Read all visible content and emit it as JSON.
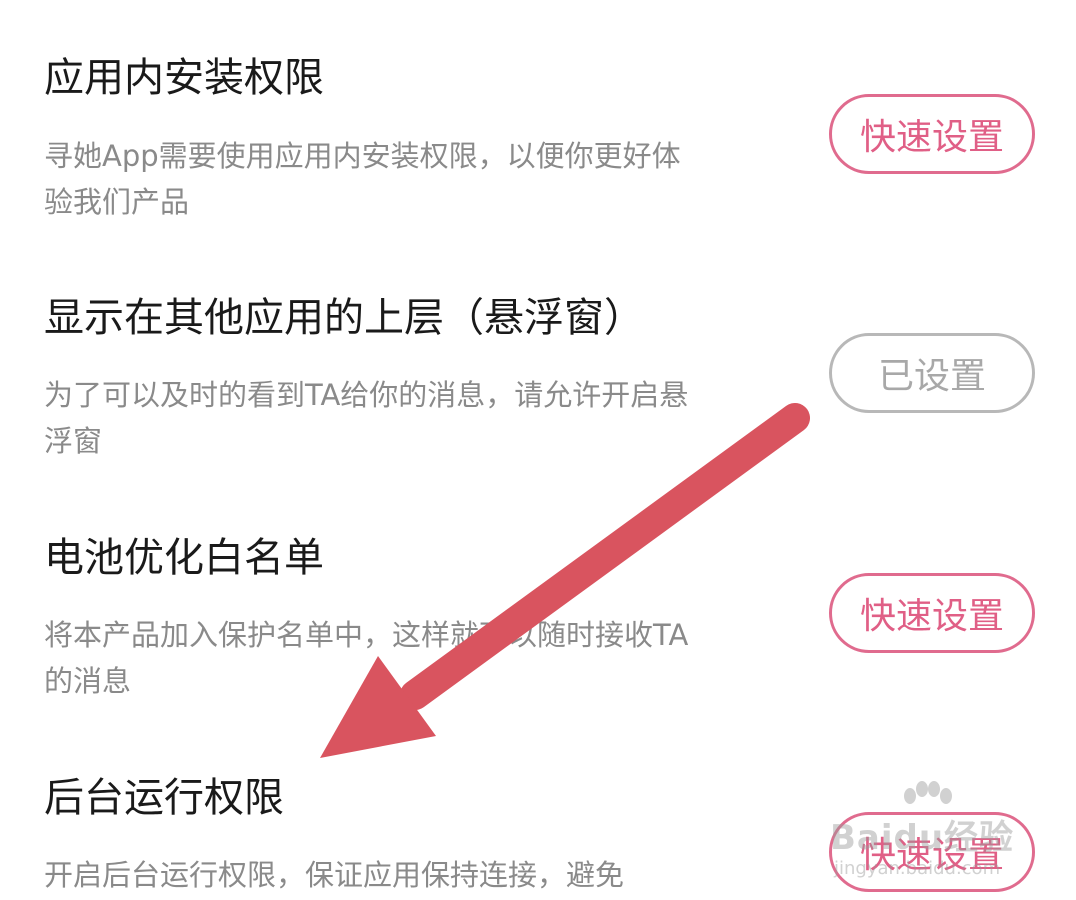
{
  "permissions": [
    {
      "title": "应用内安装权限",
      "description": "寻她App需要使用应用内安装权限，以便你更好体验我们产品",
      "button": "快速设置",
      "state": "quick"
    },
    {
      "title": "显示在其他应用的上层（悬浮窗）",
      "description": "为了可以及时的看到TA给你的消息，请允许开启悬浮窗",
      "button": "已设置",
      "state": "done"
    },
    {
      "title": "电池优化白名单",
      "description": "将本产品加入保护名单中，这样就可以随时接收TA的消息",
      "button": "快速设置",
      "state": "quick"
    },
    {
      "title": "后台运行权限",
      "description": "开启后台运行权限，保证应用保持连接，避免",
      "button": "快速设置",
      "state": "quick"
    }
  ],
  "watermark": {
    "brand": "Baidu经验",
    "url": "jingyan.baidu.com"
  },
  "colors": {
    "quick_button": "#e05f86",
    "done_button": "#a8a8a8",
    "arrow": "#d9545f"
  }
}
